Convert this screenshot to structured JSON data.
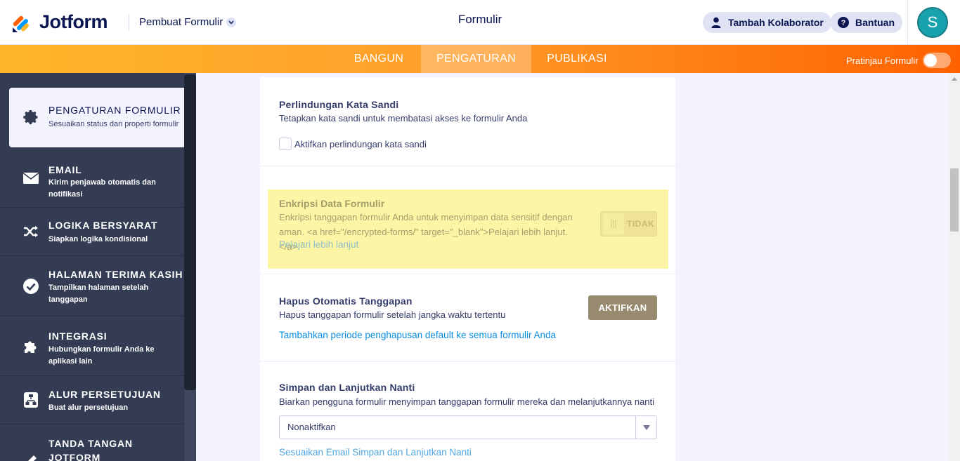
{
  "header": {
    "logo_text": "Jotform",
    "builder_menu": "Pembuat Formulir",
    "page_title": "Formulir",
    "add_collaborator": "Tambah Kolaborator",
    "help": "Bantuan",
    "avatar_initial": "S"
  },
  "nav": {
    "tabs": [
      {
        "label": "BANGUN"
      },
      {
        "label": "PENGATURAN",
        "active": true
      },
      {
        "label": "PUBLIKASI"
      }
    ],
    "preview_label": "Pratinjau Formulir",
    "preview_on": false
  },
  "sidebar": {
    "items": [
      {
        "title": "PENGATURAN FORMULIR",
        "sub": "Sesuaikan status dan properti formulir",
        "icon": "gear-icon",
        "active": true
      },
      {
        "title": "EMAIL",
        "sub": "Kirim penjawab otomatis dan notifikasi",
        "icon": "envelope-icon"
      },
      {
        "title": "LOGIKA BERSYARAT",
        "sub": "Siapkan logika kondisional",
        "icon": "shuffle-icon"
      },
      {
        "title": "HALAMAN TERIMA KASIH",
        "sub": "Tampilkan halaman setelah tanggapan",
        "icon": "check-circle-icon"
      },
      {
        "title": "INTEGRASI",
        "sub": "Hubungkan formulir Anda ke aplikasi lain",
        "icon": "puzzle-icon"
      },
      {
        "title": "ALUR PERSETUJUAN",
        "sub": "Buat alur persetujuan",
        "icon": "approval-flow-icon"
      },
      {
        "title": "TANDA TANGAN JOTFORM",
        "sub": "",
        "icon": "pen-icon"
      }
    ]
  },
  "main": {
    "password": {
      "title": "Perlindungan Kata Sandi",
      "desc": "Tetapkan kata sandi untuk membatasi akses ke formulir Anda",
      "checkbox_label": "Aktifkan perlindungan kata sandi"
    },
    "encryption": {
      "title": "Enkripsi Data Formulir",
      "desc": "Enkripsi tanggapan formulir Anda untuk menyimpan data sensitif dengan aman. <a href=\"/encrypted-forms/\" target=\"_blank\">Pelajari lebih lanjut.</a>",
      "link": "Pelajari lebih lanjut",
      "toggle_label": "TIDAK"
    },
    "autodelete": {
      "title": "Hapus Otomatis Tanggapan",
      "desc": "Hapus tanggapan formulir setelah jangka waktu tertentu",
      "button": "AKTIFKAN",
      "link": "Tambahkan periode penghapusan default ke semua formulir Anda"
    },
    "save_continue": {
      "title": "Simpan dan Lanjutkan Nanti",
      "desc": "Biarkan pengguna formulir menyimpan tanggapan formulir mereka dan melanjutkannya nanti",
      "select_value": "Nonaktifkan",
      "link": "Sesuaikan Email Simpan dan Lanjutkan Nanti"
    }
  },
  "colors": {
    "brand_navy": "#0a1551",
    "sidebar_bg": "#343c53",
    "nav_orange": "#ff6100",
    "highlight_yellow": "#fdf5a6",
    "link_blue": "#0a8ce0"
  }
}
